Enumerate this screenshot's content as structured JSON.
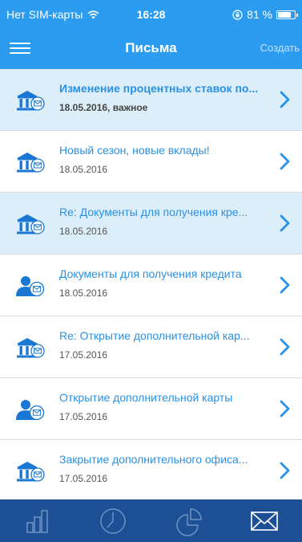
{
  "status_bar": {
    "carrier": "Нет SIM-карты",
    "time": "16:28",
    "battery_percent": "81 %",
    "battery_level": 0.81
  },
  "nav": {
    "title": "Письма",
    "create_label": "Создать"
  },
  "messages": [
    {
      "title": "Изменение процентных ставок по...",
      "date": "18.05.2016, важное",
      "icon": "bank-mail-icon",
      "unread": true,
      "highlighted": true
    },
    {
      "title": "Новый сезон, новые вклады!",
      "date": "18.05.2016",
      "icon": "bank-mail-icon",
      "unread": false,
      "highlighted": false
    },
    {
      "title": "Re: Документы для получения кре...",
      "date": "18.05.2016",
      "icon": "bank-mail-icon",
      "unread": false,
      "highlighted": true
    },
    {
      "title": "Документы для получения кредита",
      "date": "18.05.2016",
      "icon": "person-mail-icon",
      "unread": false,
      "highlighted": false
    },
    {
      "title": "Re: Открытие дополнительной кар...",
      "date": "17.05.2016",
      "icon": "bank-mail-icon",
      "unread": false,
      "highlighted": false
    },
    {
      "title": "Открытие дополнительной карты",
      "date": "17.05.2016",
      "icon": "person-mail-icon",
      "unread": false,
      "highlighted": false
    },
    {
      "title": "Закрытие дополнительного офиса...",
      "date": "17.05.2016",
      "icon": "bank-mail-icon",
      "unread": false,
      "highlighted": false
    }
  ],
  "tabs": [
    {
      "icon": "bar-chart-icon",
      "active": false
    },
    {
      "icon": "clock-icon",
      "active": false
    },
    {
      "icon": "pie-chart-icon",
      "active": false
    },
    {
      "icon": "mail-icon",
      "active": true
    }
  ],
  "colors": {
    "header_bg": "#2c9cf0",
    "accent": "#2991e6",
    "highlight_row": "#dceef9",
    "tabbar_bg": "#1c4f94",
    "icon_blue": "#1a78d4"
  }
}
